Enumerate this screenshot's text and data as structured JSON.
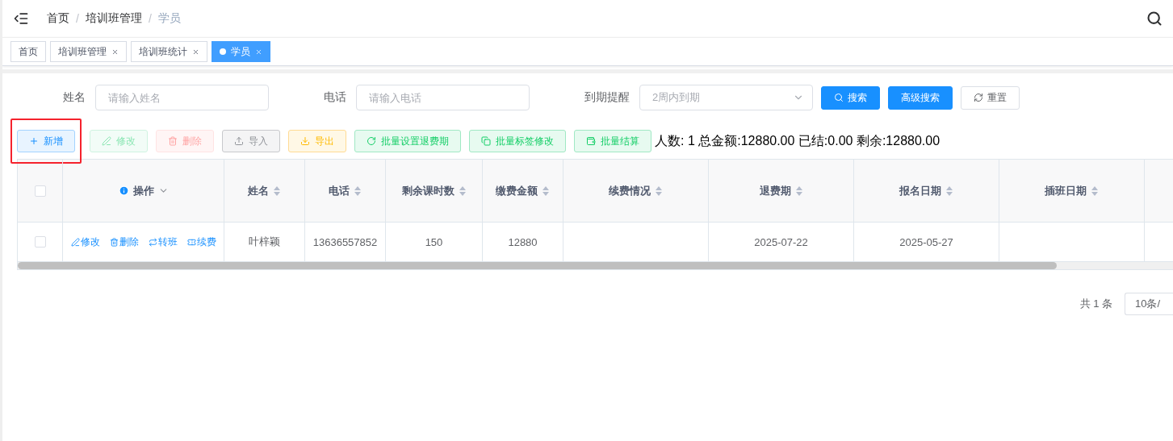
{
  "breadcrumb": {
    "separator": "/",
    "items": [
      "首页",
      "培训班管理",
      "学员"
    ]
  },
  "tabs": [
    {
      "label": "首页",
      "closable": false,
      "selected": false
    },
    {
      "label": "培训班管理",
      "closable": true,
      "selected": false
    },
    {
      "label": "培训班统计",
      "closable": true,
      "selected": false
    },
    {
      "label": "学员",
      "closable": true,
      "selected": true
    }
  ],
  "filters": [
    {
      "kind": "input",
      "label": "姓名",
      "placeholder": "请输入姓名"
    },
    {
      "kind": "input",
      "label": "电话",
      "placeholder": "请输入电话"
    },
    {
      "kind": "select",
      "label": "到期提醒",
      "placeholder": "2周内到期"
    }
  ],
  "filter_buttons": [
    {
      "kind": "primary",
      "label": "搜索"
    },
    {
      "kind": "primary",
      "label": "高级搜索"
    },
    {
      "kind": "plain",
      "label": "重置"
    }
  ],
  "toolbar": [
    {
      "kind": "primary",
      "label": "新增",
      "disabled": false,
      "highlighted": true
    },
    {
      "kind": "success",
      "label": "修改",
      "disabled": true,
      "highlighted": false
    },
    {
      "kind": "danger",
      "label": "删除",
      "disabled": true,
      "highlighted": false
    },
    {
      "kind": "info",
      "label": "导入",
      "disabled": false,
      "highlighted": false
    },
    {
      "kind": "warning",
      "label": "导出",
      "disabled": false,
      "highlighted": false
    },
    {
      "kind": "success",
      "label": "批量设置退费期",
      "disabled": false,
      "highlighted": false
    },
    {
      "kind": "success",
      "label": "批量标签修改",
      "disabled": false,
      "highlighted": false
    },
    {
      "kind": "success",
      "label": "批量结算",
      "disabled": false,
      "highlighted": false
    }
  ],
  "summary": "人数: 1 总金额:12880.00 已结:0.00 剩余:12880.00",
  "table": {
    "all_checked": false,
    "action_header": "操作",
    "columns": [
      "姓名",
      "电话",
      "剩余课时数",
      "缴费金额",
      "续费情况",
      "退费期",
      "报名日期",
      "插班日期"
    ],
    "rows": [
      {
        "checked": false,
        "actions": [
          "修改",
          "删除",
          "转班",
          "续费"
        ],
        "cells": [
          "叶梓颖",
          "13636557852",
          "150",
          "12880",
          "",
          "2025-07-22",
          "2025-05-27",
          ""
        ]
      }
    ]
  },
  "pagination": {
    "total": "共 1 条",
    "page_size": "10条/"
  }
}
